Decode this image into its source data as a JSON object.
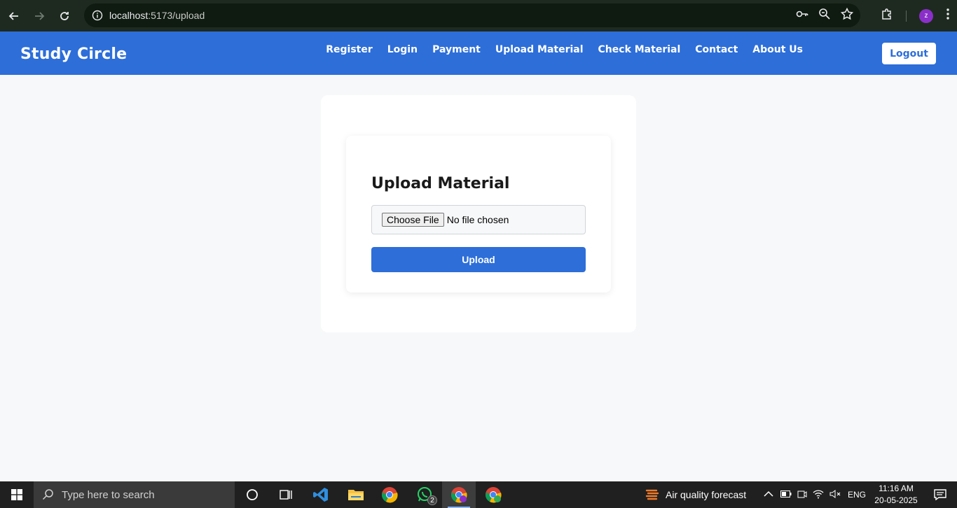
{
  "browser": {
    "url_host": "localhost",
    "url_path": ":5173/upload",
    "profile_initial": "z"
  },
  "header": {
    "brand": "Study Circle",
    "nav": [
      "Register",
      "Login",
      "Payment",
      "Upload Material",
      "Check Material",
      "Contact",
      "About Us"
    ],
    "logout_label": "Logout",
    "accent_color": "#2d6ed9"
  },
  "main": {
    "title": "Upload Material",
    "choose_file_label": "Choose File",
    "file_status": "No file chosen",
    "upload_label": "Upload"
  },
  "taskbar": {
    "search_placeholder": "Type here to search",
    "whatsapp_badge": "2",
    "weather_label": "Air quality forecast",
    "language": "ENG",
    "time": "11:16 AM",
    "date": "20-05-2025"
  }
}
